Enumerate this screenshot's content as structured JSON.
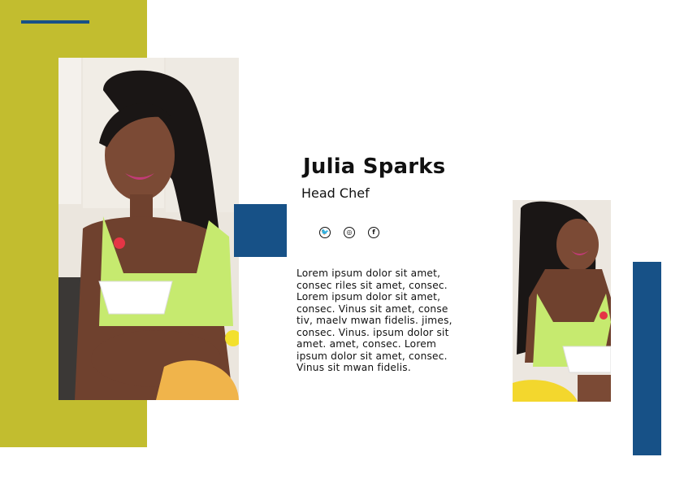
{
  "profile": {
    "name": "Julia Sparks",
    "title": "Head Chef",
    "bio": "Lorem ipsum dolor sit amet, consec  riles sit amet, consec. Lorem ipsum dolor sit amet, consec. Vinus  sit amet, conse tiv, maelv mwan fidelis. jimes, consec. Vinus.  ipsum dolor sit amet. amet, consec. Lorem ipsum dolor sit amet, consec. Vinus  sit mwan fidelis."
  },
  "social": {
    "twitter_glyph": "🐦",
    "instagram_glyph": "◎",
    "facebook_glyph": "f"
  },
  "colors": {
    "olive": "#c2bd2f",
    "blue": "#175187"
  },
  "icons": [
    "twitter-icon",
    "instagram-icon",
    "facebook-icon"
  ]
}
